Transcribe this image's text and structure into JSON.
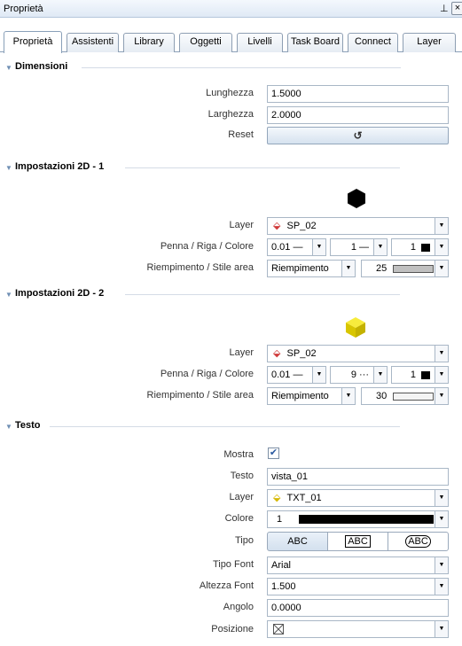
{
  "window": {
    "title": "Proprietà",
    "pin_glyph": "⊥",
    "close_glyph": "×"
  },
  "tabs": [
    {
      "label": "Proprietà"
    },
    {
      "label": "Assistenti"
    },
    {
      "label": "Library"
    },
    {
      "label": "Oggetti"
    },
    {
      "label": "Livelli"
    },
    {
      "label": "Task Board"
    },
    {
      "label": "Connect"
    },
    {
      "label": "Layer"
    }
  ],
  "dimensioni": {
    "title": "Dimensioni",
    "lunghezza_label": "Lunghezza",
    "lunghezza_value": "1.5000",
    "larghezza_label": "Larghezza",
    "larghezza_value": "2.0000",
    "reset_label": "Reset",
    "reset_icon": "undo-icon"
  },
  "imp2d1": {
    "title": "Impostazioni 2D - 1",
    "preview_icon": "black-hexagon-icon",
    "preview_color": "#000000",
    "layer_label": "Layer",
    "layer_value": "SP_02",
    "layer_icon_color": "#d03a3a",
    "penna_label": "Penna / Riga / Colore",
    "pen_value": "0.01 —",
    "line_value": "1 —",
    "color_value": "1",
    "riempimento_label": "Riempimento / Stile area",
    "fill_value": "Riempimento",
    "area_value": "25",
    "area_color": "#c0c0c0"
  },
  "imp2d2": {
    "title": "Impostazioni 2D - 2",
    "preview_icon": "yellow-cube-icon",
    "preview_color": "#e8d800",
    "layer_label": "Layer",
    "layer_value": "SP_02",
    "layer_icon_color": "#d03a3a",
    "penna_label": "Penna / Riga / Colore",
    "pen_value": "0.01 —",
    "line_value": "9 ···",
    "color_value": "1",
    "riempimento_label": "Riempimento / Stile area",
    "fill_value": "Riempimento",
    "area_value": "30",
    "area_color": "#f4f4f4"
  },
  "testo": {
    "title": "Testo",
    "mostra_label": "Mostra",
    "mostra_checked": "✔",
    "testo_label": "Testo",
    "testo_value": "vista_01",
    "layer_label": "Layer",
    "layer_value": "TXT_01",
    "layer_icon_color": "#d6b800",
    "colore_label": "Colore",
    "colore_value": "1",
    "tipo_label": "Tipo",
    "tipo_options": [
      "ABC",
      "ABC",
      "ABC"
    ],
    "tipofont_label": "Tipo Font",
    "tipofont_value": "Arial",
    "altezza_label": "Altezza Font",
    "altezza_value": "1.500",
    "angolo_label": "Angolo",
    "angolo_value": "0.0000",
    "posizione_label": "Posizione",
    "posizione_icon": "anchor-position-icon"
  }
}
